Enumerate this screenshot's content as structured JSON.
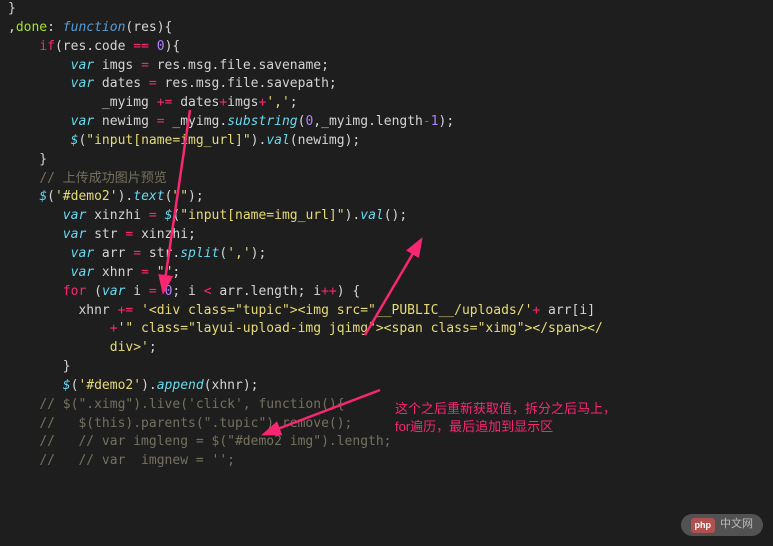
{
  "code": {
    "l1": "}",
    "l2a": ",",
    "l2b": "done",
    "l2c": ": ",
    "l2d": "function",
    "l2e": "(",
    "l2f": "res",
    "l2g": "){",
    "l3a": "    ",
    "l3b": "if",
    "l3c": "(res.code ",
    "l3d": "==",
    "l3e": " ",
    "l3f": "0",
    "l3g": "){",
    "l4a": "        ",
    "l4b": "var",
    "l4c": " imgs ",
    "l4d": "=",
    "l4e": " res.msg.file.savename;",
    "l5a": "        ",
    "l5b": "var",
    "l5c": " dates ",
    "l5d": "=",
    "l5e": " res.msg.file.savepath;",
    "l6a": "            _myimg ",
    "l6b": "+=",
    "l6c": " dates",
    "l6d": "+",
    "l6e": "imgs",
    "l6f": "+",
    "l6g": "','",
    "l6h": ";",
    "l7a": "        ",
    "l7b": "var",
    "l7c": " newimg ",
    "l7d": "=",
    "l7e": " _myimg.",
    "l7f": "substring",
    "l7g": "(",
    "l7h": "0",
    "l7i": ",_myimg.length",
    "l7j": "-",
    "l7k": "1",
    "l7l": ");",
    "l8a": "        ",
    "l8b": "$",
    "l8c": "(",
    "l8d": "\"input[name=img_url]\"",
    "l8e": ").",
    "l8f": "val",
    "l8g": "(newimg);",
    "l9": "    }",
    "l10a": "    ",
    "l10b": "// 上传成功图片预览",
    "l11a": "    ",
    "l11b": "$",
    "l11c": "(",
    "l11d": "'#demo2'",
    "l11e": ").",
    "l11f": "text",
    "l11g": "(",
    "l11h": "\"\"",
    "l11i": ");",
    "l12a": "       ",
    "l12b": "var",
    "l12c": " xinzhi ",
    "l12d": "=",
    "l12e": " ",
    "l12f": "$",
    "l12g": "(",
    "l12h": "\"input[name=img_url]\"",
    "l12i": ").",
    "l12j": "val",
    "l12k": "();",
    "l13a": "       ",
    "l13b": "var",
    "l13c": " str ",
    "l13d": "=",
    "l13e": " xinzhi;",
    "l14a": "        ",
    "l14b": "var",
    "l14c": " arr ",
    "l14d": "=",
    "l14e": " str.",
    "l14f": "split",
    "l14g": "(",
    "l14h": "','",
    "l14i": ");",
    "l15a": "        ",
    "l15b": "var",
    "l15c": " xhnr ",
    "l15d": "=",
    "l15e": " ",
    "l15f": "\"\"",
    "l15g": ";",
    "l16a": "       ",
    "l16b": "for",
    "l16c": " (",
    "l16d": "var",
    "l16e": " i ",
    "l16f": "=",
    "l16g": " ",
    "l16h": "0",
    "l16i": "; i ",
    "l16j": "<",
    "l16k": " arr.length; i",
    "l16l": "++",
    "l16m": ") {",
    "l17a": "         xhnr ",
    "l17b": "+=",
    "l17c": " ",
    "l17d": "'<div class=\"tupic\"><img src=\"__PUBLIC__/uploads/'",
    "l17e": "+",
    "l17f": " arr[i]",
    "l18a": "             ",
    "l18b": "+",
    "l18c": "'\" class=\"layui-upload-img jqimg\"><span class=\"ximg\"></span></",
    "l19a": "             ",
    "l19b": "div>'",
    "l19c": ";",
    "l20a": "       }",
    "l21a": "       ",
    "l21b": "$",
    "l21c": "(",
    "l21d": "'#demo2'",
    "l21e": ").",
    "l21f": "append",
    "l21g": "(xhnr);",
    "l22a": "    ",
    "l22b": "// $(\".ximg\").live('click', function(){",
    "l23a": "    ",
    "l23b": "//   $(this).parents(\".tupic\").remove();",
    "l24a": "    ",
    "l24b": "//   // var imgleng = $(\"#demo2 img\").length;",
    "l25a": "    ",
    "l25b": "//   // var  imgnew = '';"
  },
  "annotation": {
    "line1": "这个之后重新获取值，拆分之后马上，",
    "line2": "for遍历，最后追加到显示区"
  },
  "watermark": {
    "badge": "php",
    "text": "中文网"
  }
}
